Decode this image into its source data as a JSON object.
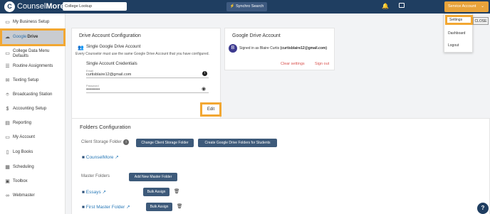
{
  "header": {
    "brand_prefix": "Counsel",
    "brand_bold": "More",
    "college_search_value": "College Lookup",
    "synchro_label": "Synchro Search",
    "service_account_label": "Service Account"
  },
  "dropdown": {
    "settings": "Settings",
    "dashboard": "Dashboard",
    "logout": "Logout",
    "close": "CLOSE"
  },
  "sidebar": {
    "items": [
      {
        "label": "My Business Setup",
        "icon": "page-icon"
      },
      {
        "label_prefix": "Google",
        "label_bold": "Drive",
        "icon": "cloud-icon"
      },
      {
        "label": "College Data Menu Defaults",
        "icon": "page-icon"
      },
      {
        "label": "Routine Assignments",
        "icon": "list-icon"
      },
      {
        "label": "Texting Setup",
        "icon": "chat-icon"
      },
      {
        "label": "Broadcasting Station",
        "icon": "broadcast-icon"
      },
      {
        "label": "Accounting Setup",
        "icon": "dollar-icon"
      },
      {
        "label": "Reporting",
        "icon": "report-icon"
      },
      {
        "label": "My Account",
        "icon": "monitor-icon"
      },
      {
        "label": "Log Books",
        "icon": "book-icon"
      },
      {
        "label": "Scheduling",
        "icon": "calendar-icon"
      },
      {
        "label": "Toolbox",
        "icon": "toolbox-icon"
      },
      {
        "label": "Webmaster",
        "icon": "link-icon"
      }
    ]
  },
  "drive_config": {
    "title": "Drive Account Configuration",
    "single_title": "Single Google Drive Account",
    "single_desc": "Every Counselor must use the same Google Drive Account that you have configured.",
    "creds_title": "Single Account Credentials",
    "email_label": "Email",
    "email_value": "curtisblaire12@gmail.com",
    "password_label": "Password",
    "password_value": "••••••••••",
    "edit": "Edit"
  },
  "google_account": {
    "title": "Google Drive Account",
    "avatar_letter": "B",
    "signed_in_prefix": "Signed in as Blaire Curtis",
    "signed_in_email": "(curtisblaire12@gmail.com)",
    "clear": "Clear settings",
    "signout": "Sign out"
  },
  "folders": {
    "title": "Folders Configuration",
    "client_label": "Client Storage Folder",
    "change_client": "Change Client Storage Folder",
    "create_drive": "Create Google Drive Folders for Students",
    "client_folder": "CounselMore",
    "master_label": "Master Folders",
    "add_master": "Add New Master Folder",
    "master_items": [
      {
        "name": "Essays",
        "action": "Bulk Assign"
      },
      {
        "name": "First Master Folder",
        "action": "Bulk Assign"
      }
    ]
  },
  "help": "?",
  "colors": {
    "navy": "#1f3e61",
    "orange": "#e8a33a",
    "button": "#3d5a7a",
    "link": "#2a7ab8",
    "red": "#d9534f",
    "highlight": "#f2a732"
  }
}
